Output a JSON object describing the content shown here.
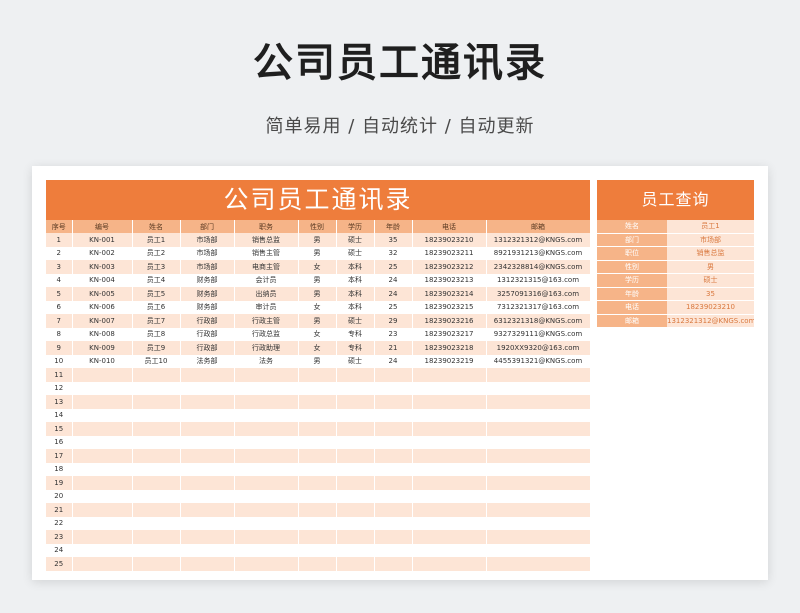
{
  "hero": {
    "title": "公司员工通讯录",
    "subtitle": "简单易用 / 自动统计 / 自动更新"
  },
  "sheet": {
    "banner": "公司员工通讯录",
    "columns": [
      "序号",
      "编号",
      "姓名",
      "部门",
      "职务",
      "性别",
      "学历",
      "年龄",
      "电话",
      "邮箱"
    ],
    "rows": [
      [
        "1",
        "KN-001",
        "员工1",
        "市场部",
        "销售总监",
        "男",
        "硕士",
        "35",
        "18239023210",
        "1312321312@KNGS.com"
      ],
      [
        "2",
        "KN-002",
        "员工2",
        "市场部",
        "销售主管",
        "男",
        "硕士",
        "32",
        "18239023211",
        "8921931213@KNGS.com"
      ],
      [
        "3",
        "KN-003",
        "员工3",
        "市场部",
        "电商主管",
        "女",
        "本科",
        "25",
        "18239023212",
        "2342328814@KNGS.com"
      ],
      [
        "4",
        "KN-004",
        "员工4",
        "财务部",
        "会计员",
        "男",
        "本科",
        "24",
        "18239023213",
        "1312321315@163.com"
      ],
      [
        "5",
        "KN-005",
        "员工5",
        "财务部",
        "出纳员",
        "男",
        "本科",
        "24",
        "18239023214",
        "3257091316@163.com"
      ],
      [
        "6",
        "KN-006",
        "员工6",
        "财务部",
        "审计员",
        "女",
        "本科",
        "25",
        "18239023215",
        "7312321317@163.com"
      ],
      [
        "7",
        "KN-007",
        "员工7",
        "行政部",
        "行政主管",
        "男",
        "硕士",
        "29",
        "18239023216",
        "6312321318@KNGS.com"
      ],
      [
        "8",
        "KN-008",
        "员工8",
        "行政部",
        "行政总监",
        "女",
        "专科",
        "23",
        "18239023217",
        "9327329111@KNGS.com"
      ],
      [
        "9",
        "KN-009",
        "员工9",
        "行政部",
        "行政助理",
        "女",
        "专科",
        "21",
        "18239023218",
        "1920XX9320@163.com"
      ],
      [
        "10",
        "KN-010",
        "员工10",
        "法务部",
        "法务",
        "男",
        "硕士",
        "24",
        "18239023219",
        "4455391321@KNGS.com"
      ],
      [
        "11",
        "",
        "",
        "",
        "",
        "",
        "",
        "",
        "",
        ""
      ],
      [
        "12",
        "",
        "",
        "",
        "",
        "",
        "",
        "",
        "",
        ""
      ],
      [
        "13",
        "",
        "",
        "",
        "",
        "",
        "",
        "",
        "",
        ""
      ],
      [
        "14",
        "",
        "",
        "",
        "",
        "",
        "",
        "",
        "",
        ""
      ],
      [
        "15",
        "",
        "",
        "",
        "",
        "",
        "",
        "",
        "",
        ""
      ],
      [
        "16",
        "",
        "",
        "",
        "",
        "",
        "",
        "",
        "",
        ""
      ],
      [
        "17",
        "",
        "",
        "",
        "",
        "",
        "",
        "",
        "",
        ""
      ],
      [
        "18",
        "",
        "",
        "",
        "",
        "",
        "",
        "",
        "",
        ""
      ],
      [
        "19",
        "",
        "",
        "",
        "",
        "",
        "",
        "",
        "",
        ""
      ],
      [
        "20",
        "",
        "",
        "",
        "",
        "",
        "",
        "",
        "",
        ""
      ],
      [
        "21",
        "",
        "",
        "",
        "",
        "",
        "",
        "",
        "",
        ""
      ],
      [
        "22",
        "",
        "",
        "",
        "",
        "",
        "",
        "",
        "",
        ""
      ],
      [
        "23",
        "",
        "",
        "",
        "",
        "",
        "",
        "",
        "",
        ""
      ],
      [
        "24",
        "",
        "",
        "",
        "",
        "",
        "",
        "",
        "",
        ""
      ],
      [
        "25",
        "",
        "",
        "",
        "",
        "",
        "",
        "",
        "",
        ""
      ]
    ]
  },
  "lookup": {
    "title": "员工查询",
    "fields": [
      {
        "key": "姓名",
        "value": "员工1"
      },
      {
        "key": "部门",
        "value": "市场部"
      },
      {
        "key": "职位",
        "value": "销售总监"
      },
      {
        "key": "性别",
        "value": "男"
      },
      {
        "key": "学历",
        "value": "硕士"
      },
      {
        "key": "年龄",
        "value": "35"
      },
      {
        "key": "电话",
        "value": "18239023210"
      },
      {
        "key": "邮箱",
        "value": "1312321312@KNGS.com"
      }
    ]
  },
  "colors": {
    "accent": "#ee7d3c",
    "header_fill": "#f6b488",
    "stripe": "#fde5d6"
  }
}
